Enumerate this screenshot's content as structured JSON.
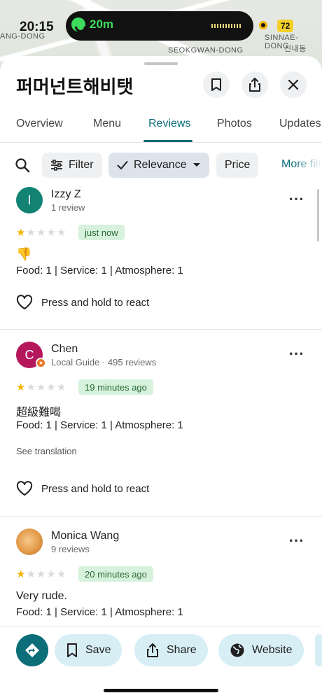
{
  "status_bar": {
    "time": "20:15",
    "call_duration": "20m",
    "speed_badge": "72"
  },
  "map": {
    "labels": [
      "ANG-DONG",
      "SINNAE-DONG",
      "신내동",
      "SEOKGWAN-DONG"
    ]
  },
  "place": {
    "title": "퍼머넌트해비탯"
  },
  "tabs": [
    {
      "label": "Overview"
    },
    {
      "label": "Menu"
    },
    {
      "label": "Reviews",
      "active": true
    },
    {
      "label": "Photos"
    },
    {
      "label": "Updates"
    }
  ],
  "filters": {
    "filter_label": "Filter",
    "sort_label": "Relevance",
    "price_label": "Price",
    "more_label": "More filters"
  },
  "reviews": [
    {
      "initial": "I",
      "avatar_color": "#128373",
      "name": "Izzy Z",
      "meta": "1 review",
      "stars": 1,
      "time": "just now",
      "text": "👎",
      "ratings": "Food: 1 | Service: 1 | Atmosphere: 1",
      "react_label": "Press and hold to react"
    },
    {
      "initial": "C",
      "avatar_color": "#b5175d",
      "name": "Chen",
      "meta": "Local Guide · 495 reviews",
      "stars": 1,
      "time": "19 minutes ago",
      "text": "超級難喝",
      "ratings": "Food: 1 | Service: 1 | Atmosphere: 1",
      "see_translation": "See translation",
      "react_label": "Press and hold to react"
    },
    {
      "initial": "",
      "avatar_color": "#e39b4a",
      "name": "Monica Wang",
      "meta": "9 reviews",
      "stars": 1,
      "time": "20 minutes ago",
      "text": "Very rude.",
      "ratings": "Food: 1 | Service: 1 | Atmosphere: 1"
    }
  ],
  "bottom_actions": {
    "save_label": "Save",
    "share_label": "Share",
    "website_label": "Website"
  },
  "colors": {
    "accent": "#0b6e79",
    "star": "#f5b301",
    "chip_bg": "#d7eef4"
  }
}
